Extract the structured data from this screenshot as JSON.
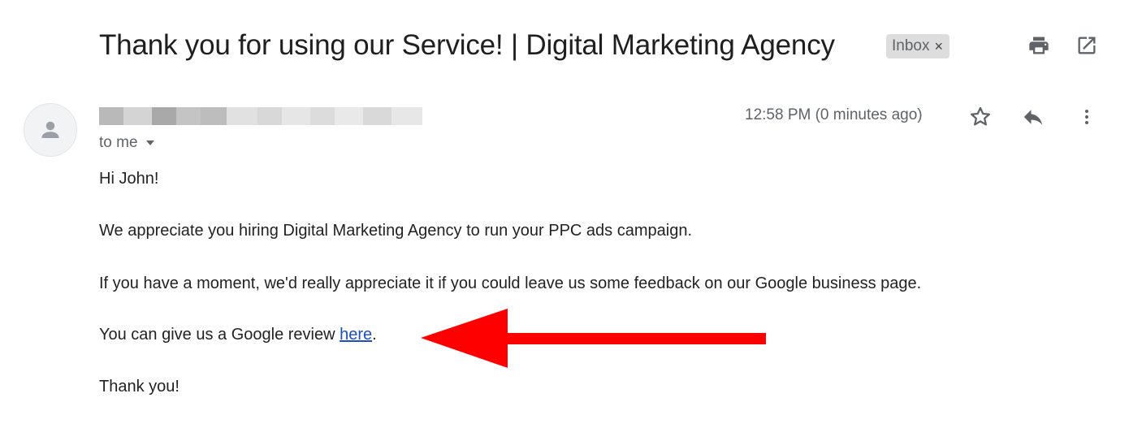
{
  "email": {
    "subject": "Thank you for using our Service! | Digital Marketing Agency",
    "label": "Inbox",
    "label_remove": "×",
    "recipient": "to me",
    "timestamp": "12:58 PM (0 minutes ago)",
    "body": {
      "greeting": "Hi John!",
      "paragraph1": "We appreciate you hiring Digital Marketing Agency to run your PPC ads campaign.",
      "paragraph2": "If you have a moment, we'd really appreciate it if you could leave us some feedback on our Google business page.",
      "paragraph3_prefix": "You can give us a Google review ",
      "paragraph3_link": "here",
      "paragraph3_suffix": ".",
      "closing": "Thank you!"
    }
  },
  "icons": {
    "print": "print-icon",
    "open_new_window": "open-in-new-window-icon",
    "avatar": "default-avatar-icon",
    "star": "star-icon",
    "reply": "reply-icon",
    "more": "more-vertical-icon",
    "recipient_caret": "caret-down-icon",
    "annotation_arrow": "red-arrow-left"
  },
  "colors": {
    "annotation_arrow": "#ff0000",
    "link": "#1a4fc8",
    "label_chip_bg": "#dddddd"
  }
}
